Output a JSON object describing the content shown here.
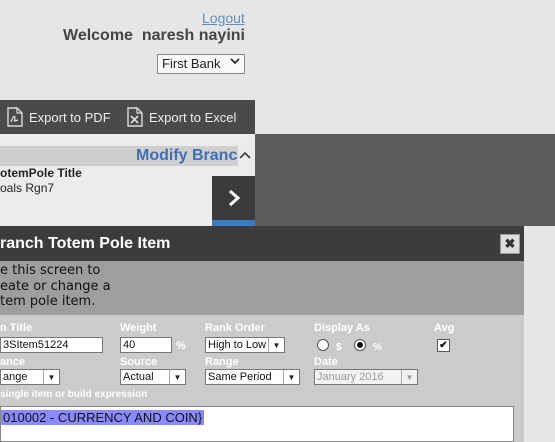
{
  "header": {
    "logout_label": "Logout",
    "welcome_text": "Welcome  naresh nayini",
    "bank_select": {
      "value": "First Bank",
      "icon": "chevron-down-icon"
    }
  },
  "toolbar": {
    "export_pdf_label": "Export to PDF",
    "export_excel_label": "Export to Excel"
  },
  "panel": {
    "title": "Modify Branc",
    "totem_pole_title_label": "otemPole Title",
    "totem_pole_title_value": "oals Rgn7"
  },
  "modal": {
    "title": "ranch Totem Pole Item",
    "close_icon": "close-icon",
    "intro_lines": [
      "e this screen to",
      "eate or change a",
      "tem pole item."
    ],
    "fields": {
      "item_title_label": "n Title",
      "item_title_value": "3SItem51224",
      "weight_label": "Weight",
      "weight_value": "40",
      "weight_unit": "%",
      "rank_order_label": "Rank Order",
      "rank_order_value": "High to Low",
      "display_as_label": "Display As",
      "display_as_options": [
        "$",
        "%"
      ],
      "display_as_selected": "%",
      "avg_label": "Avg",
      "avg_checked": true,
      "balance_label": "ance",
      "balance_value": "ange",
      "source_label": "Source",
      "source_value": "Actual",
      "range_label": "Range",
      "range_value": "Same Period",
      "date_label": "Date",
      "date_value": "January 2016",
      "expression_label": "single item or build expression",
      "expression_value": "010002 - CURRENCY AND COIN}"
    }
  }
}
